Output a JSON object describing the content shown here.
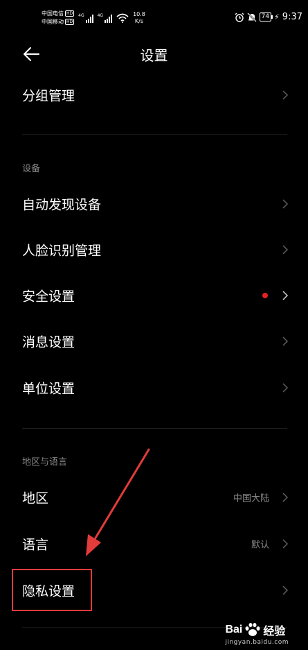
{
  "status_bar": {
    "carrier_1": "中国电信",
    "carrier_2": "中国移动",
    "hd_badge": "HD",
    "network_gen": "4G",
    "speed_value": "10.8",
    "speed_unit": "K/s",
    "battery": "74",
    "time": "9:37"
  },
  "header": {
    "title": "设置"
  },
  "sections": [
    {
      "label": "设备"
    },
    {
      "label": "地区与语言"
    }
  ],
  "rows": [
    {
      "label": "分组管理",
      "value": ""
    },
    {
      "label": "自动发现设备",
      "value": ""
    },
    {
      "label": "人脸识别管理",
      "value": ""
    },
    {
      "label": "安全设置",
      "value": ""
    },
    {
      "label": "消息设置",
      "value": ""
    },
    {
      "label": "单位设置",
      "value": ""
    },
    {
      "label": "地区",
      "value": "中国大陆"
    },
    {
      "label": "语言",
      "value": "默认"
    },
    {
      "label": "隐私设置",
      "value": ""
    }
  ],
  "watermark": {
    "brand_left": "Bai",
    "brand_right": "经验",
    "url": "jingyan.baidu.com"
  },
  "colors": {
    "background": "#000000",
    "secondary_text": "#8a8a8a",
    "notification_dot": "#e1231f",
    "annotation": "#e23b3b"
  }
}
